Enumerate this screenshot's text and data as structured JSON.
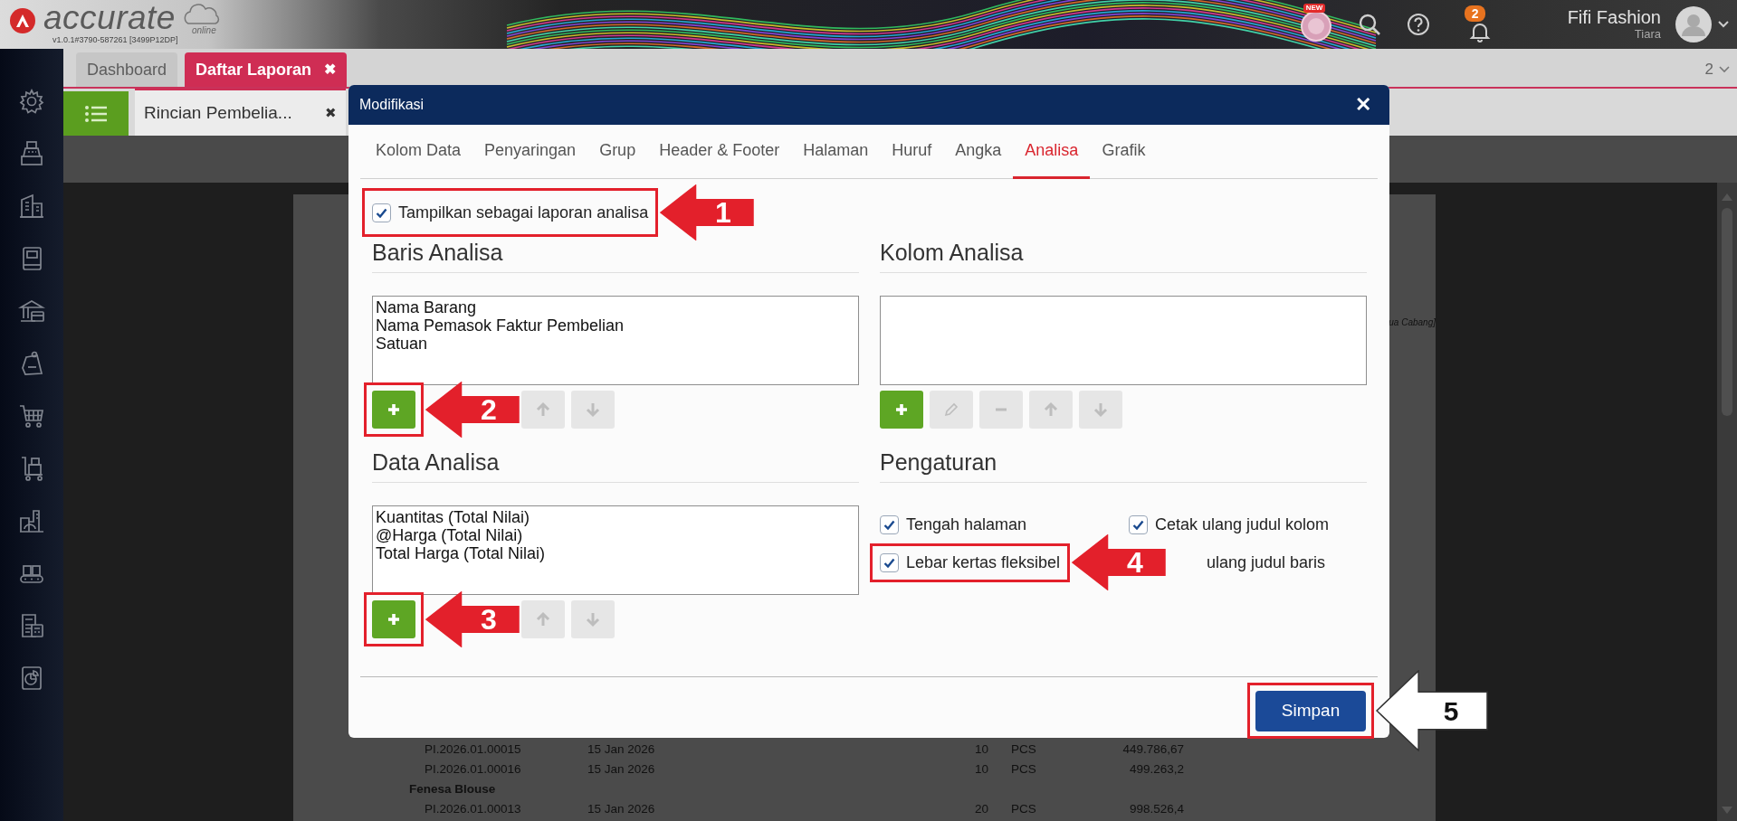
{
  "app": {
    "logo": "accurate",
    "logo_sub": "online",
    "version": "v1.0.1#3790-587261 [3499P12DP]"
  },
  "header": {
    "new_badge": "NEW",
    "notification_count": "2",
    "user_name": "Fifi Fashion",
    "user_role": "Tiara"
  },
  "sidebar": {
    "items": [
      {
        "kind": "settings"
      },
      {
        "kind": "register"
      },
      {
        "kind": "building"
      },
      {
        "kind": "book"
      },
      {
        "kind": "bank"
      },
      {
        "kind": "price-tag"
      },
      {
        "kind": "cart"
      },
      {
        "kind": "hand-truck"
      },
      {
        "kind": "factory"
      },
      {
        "kind": "conveyor"
      },
      {
        "kind": "tax-document"
      },
      {
        "kind": "chart-document"
      }
    ]
  },
  "main_tabs": [
    {
      "label": "Dashboard",
      "selected": false
    },
    {
      "label": "Daftar Laporan",
      "selected": true,
      "close": "✖"
    }
  ],
  "window_count": "2",
  "sub_tabs": [
    {
      "label": "Rincian Pembelia...",
      "selected": true,
      "close": "✖"
    }
  ],
  "report": {
    "header_fragment": "ua Cabang]",
    "rows": [
      {
        "kind": "detail",
        "cells": [
          "PI.2026.01.00015",
          "15 Jan 2026",
          "10",
          "PCS",
          "449.786,67"
        ]
      },
      {
        "kind": "detail",
        "cells": [
          "PI.2026.01.00016",
          "15 Jan 2026",
          "10",
          "PCS",
          "499.263,2"
        ]
      },
      {
        "kind": "group",
        "cells": [
          "Fenesa Blouse"
        ]
      },
      {
        "kind": "detail",
        "cells": [
          "PI.2026.01.00013",
          "15 Jan 2026",
          "20",
          "PCS",
          "998.526,4"
        ]
      }
    ]
  },
  "dialog": {
    "title": "Modifikasi",
    "close": "✕",
    "tabs": [
      {
        "label": "Kolom Data",
        "selected": false
      },
      {
        "label": "Penyaringan",
        "selected": false
      },
      {
        "label": "Grup",
        "selected": false
      },
      {
        "label": "Header & Footer",
        "selected": false
      },
      {
        "label": "Halaman",
        "selected": false
      },
      {
        "label": "Huruf",
        "selected": false
      },
      {
        "label": "Angka",
        "selected": false
      },
      {
        "label": "Analisa",
        "selected": true
      },
      {
        "label": "Grafik",
        "selected": false
      }
    ],
    "show_analysis": {
      "label": "Tampilkan sebagai laporan analisa",
      "checked": true,
      "callout": {
        "number": "1",
        "color": "#e3202b"
      }
    },
    "row_analysis": {
      "title": "Baris Analisa",
      "items": [
        "Nama Barang",
        "Nama Pemasok Faktur Pembelian",
        "Satuan"
      ],
      "toolbar": [
        {
          "kind": "add",
          "disabled": false,
          "callout": {
            "number": "2",
            "color": "#e3202b"
          }
        },
        {
          "kind": "covered"
        },
        {
          "kind": "covered"
        },
        {
          "kind": "up",
          "disabled": true
        },
        {
          "kind": "down",
          "disabled": true
        }
      ]
    },
    "column_analysis": {
      "title": "Kolom Analisa",
      "toolbar": [
        {
          "kind": "add",
          "disabled": false
        },
        {
          "kind": "edit",
          "disabled": true
        },
        {
          "kind": "remove",
          "disabled": true
        },
        {
          "kind": "up",
          "disabled": true
        },
        {
          "kind": "down",
          "disabled": true
        }
      ]
    },
    "data_analysis": {
      "title": "Data Analisa",
      "items": [
        "Kuantitas (Total Nilai)",
        "@Harga (Total Nilai)",
        "Total Harga (Total Nilai)"
      ],
      "toolbar": [
        {
          "kind": "add",
          "disabled": false,
          "callout": {
            "number": "3",
            "color": "#e3202b"
          }
        },
        {
          "kind": "covered"
        },
        {
          "kind": "covered"
        },
        {
          "kind": "up",
          "disabled": true
        },
        {
          "kind": "down",
          "disabled": true
        }
      ]
    },
    "settings": {
      "title": "Pengaturan",
      "options": [
        {
          "kind": "checkbox",
          "label": "Tengah halaman",
          "checked": true
        },
        {
          "kind": "checkbox",
          "label": "Cetak ulang judul kolom",
          "checked": true
        },
        {
          "kind": "checkbox",
          "label": "Lebar kertas fleksibel",
          "checked": true,
          "callout": {
            "number": "4",
            "color": "#e3202b"
          }
        },
        {
          "kind": "covered",
          "label": "ulang judul baris"
        }
      ]
    },
    "save_button": {
      "label": "Simpan",
      "callout": {
        "number": "5",
        "color": "#ffffff"
      }
    }
  }
}
